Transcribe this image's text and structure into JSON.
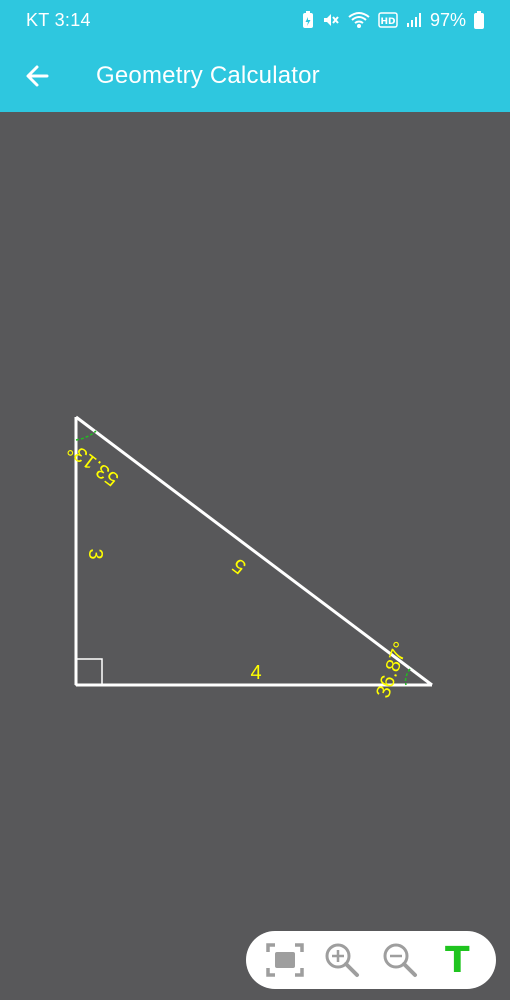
{
  "status_bar": {
    "time": "KT 3:14",
    "battery": "97%",
    "icons": [
      "battery-saver-icon",
      "mute-icon",
      "wifi-icon",
      "hd-icon",
      "signal-icon",
      "battery-icon"
    ]
  },
  "app_bar": {
    "title": "Geometry Calculator",
    "back_icon": "arrow-left-icon"
  },
  "triangle": {
    "side_vertical": "3",
    "side_horizontal": "4",
    "hypotenuse": "5",
    "angle_top": "53.13°",
    "angle_right": "36.87°",
    "right_angle_marker": true,
    "colors": {
      "lines": "#ffffff",
      "labels": "#ffff00",
      "angle_arc": "#22bb22"
    }
  },
  "toolbar": {
    "buttons": [
      "fit-screen-icon",
      "zoom-in-icon",
      "zoom-out-icon",
      "text-toggle-icon"
    ],
    "text_toggle_label": "T",
    "text_toggle_color": "#1fc41f"
  }
}
